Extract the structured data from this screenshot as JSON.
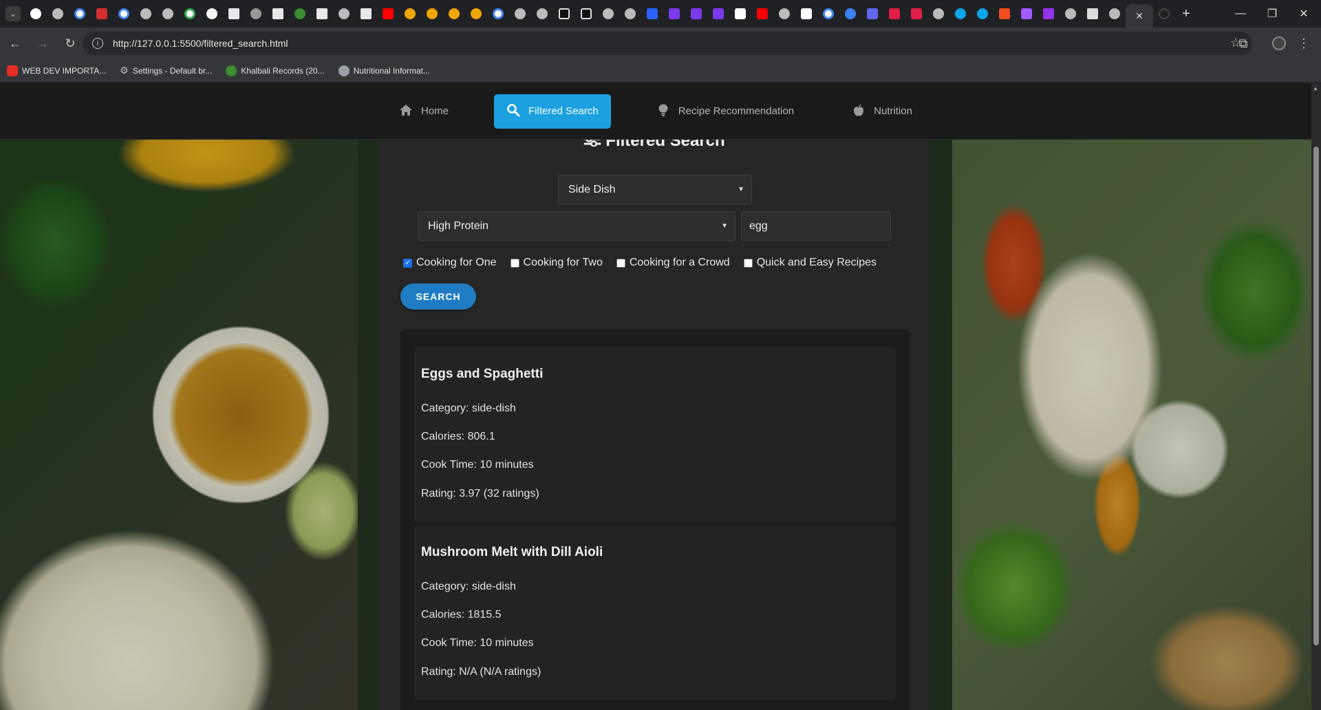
{
  "browser": {
    "url": "http://127.0.0.1:5500/filtered_search.html",
    "bookmarks": [
      {
        "label": "WEB DEV IMPORTA...",
        "color": "#e52d27"
      },
      {
        "label": "Settings - Default br...",
        "color": "#9aa0a6"
      },
      {
        "label": "Khalbali Records (20...",
        "color": "#3c8d2f"
      },
      {
        "label": "Nutritional Informat...",
        "color": "#9aa0a6"
      }
    ]
  },
  "nav": {
    "items": [
      {
        "label": "Home",
        "icon": "home-icon"
      },
      {
        "label": "Filtered Search",
        "icon": "search-icon",
        "active": true
      },
      {
        "label": "Recipe Recommendation",
        "icon": "lightbulb-icon"
      },
      {
        "label": "Nutrition",
        "icon": "apple-icon"
      }
    ]
  },
  "form": {
    "title": "Filtered Search",
    "category_value": "Side Dish",
    "diet_value": "High Protein",
    "ingredient_value": "egg",
    "checkboxes": [
      {
        "label": "Cooking for One",
        "checked": true
      },
      {
        "label": "Cooking for Two",
        "checked": false
      },
      {
        "label": "Cooking for a Crowd",
        "checked": false
      },
      {
        "label": "Quick and Easy Recipes",
        "checked": false
      }
    ],
    "search_label": "SEARCH"
  },
  "results": [
    {
      "title": "Eggs and Spaghetti",
      "category": "Category: side-dish",
      "calories": "Calories: 806.1",
      "cook_time": "Cook Time: 10 minutes",
      "rating": "Rating: 3.97 (32 ratings)"
    },
    {
      "title": "Mushroom Melt with Dill Aioli",
      "category": "Category: side-dish",
      "calories": "Calories: 1815.5",
      "cook_time": "Cook Time: 10 minutes",
      "rating": "Rating: N/A (N/A ratings)"
    }
  ]
}
